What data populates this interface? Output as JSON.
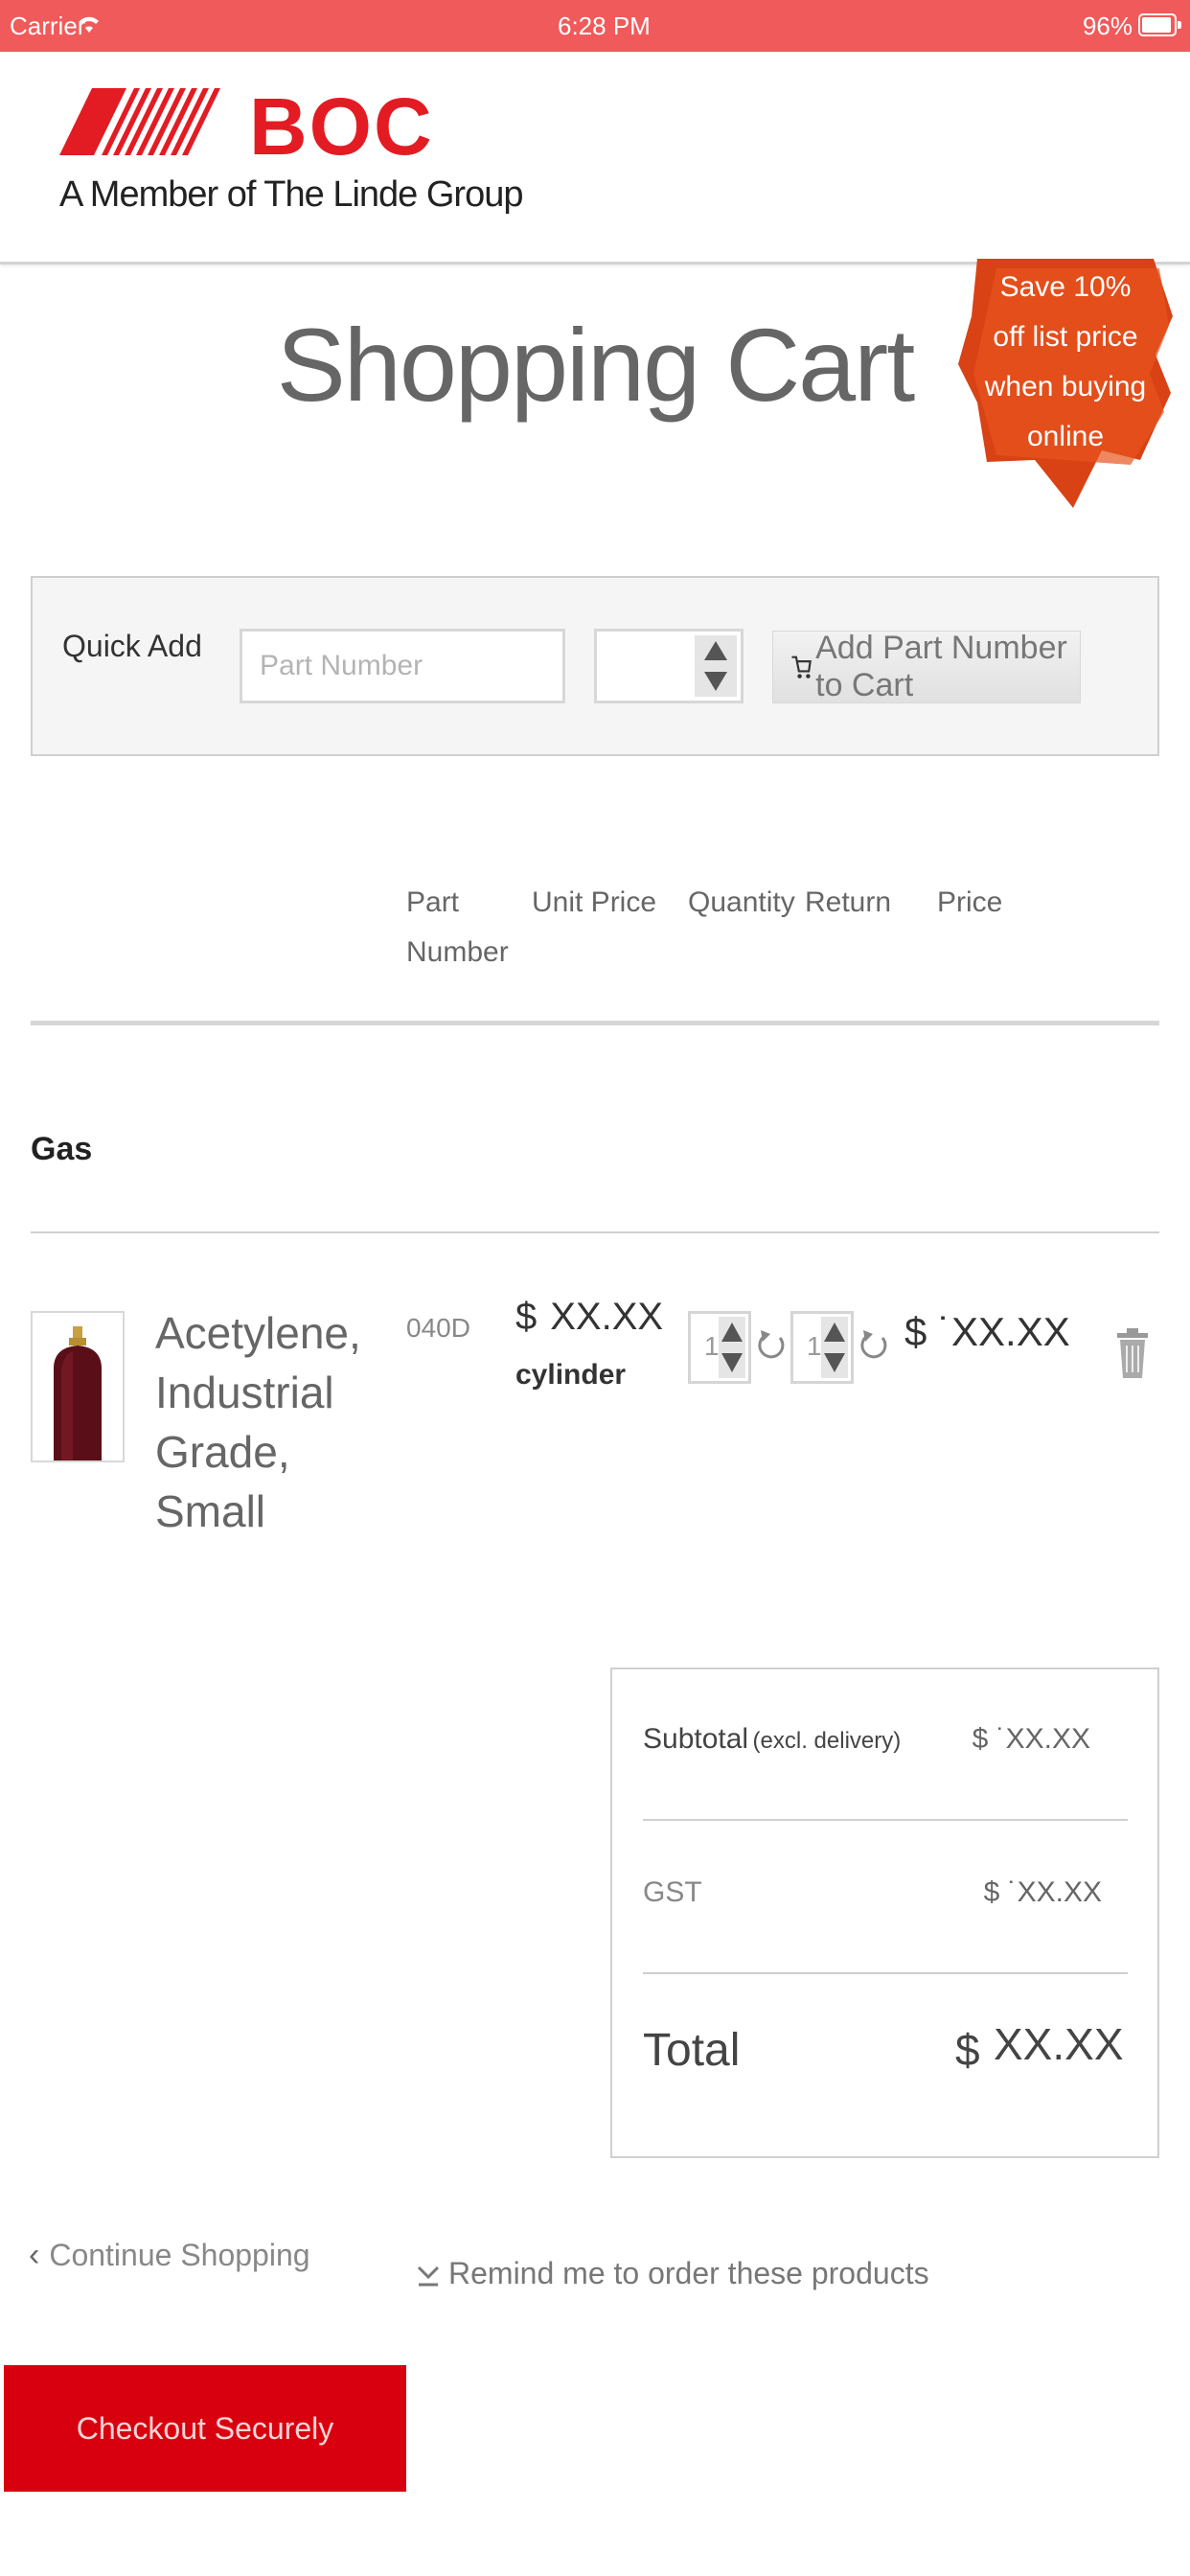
{
  "status_bar": {
    "carrier": "Carrier",
    "time": "6:28 PM",
    "battery": "96%"
  },
  "header": {
    "logo": "BOC",
    "tagline": "A Member of The Linde Group"
  },
  "page_title": "Shopping Cart",
  "badge": {
    "line1": "Save 10%",
    "line2": "off list price",
    "line3": "when buying",
    "line4": "online"
  },
  "quick_add": {
    "label": "Quick Add",
    "part_placeholder": "Part Number",
    "add_button": "Add Part Number to Cart"
  },
  "table_headers": {
    "part_number_line1": "Part",
    "part_number_line2": "Number",
    "unit_price": "Unit Price",
    "quantity": "Quantity",
    "return": "Return",
    "price": "Price"
  },
  "category": "Gas",
  "item": {
    "name_line1": "Acetylene,",
    "name_line2": "Industrial",
    "name_line3": "Grade, Small",
    "part_number": "040D",
    "currency": "$",
    "unit_price": "XX.XX",
    "unit": "cylinder",
    "quantity": "1",
    "return_qty": "1",
    "line_price": "$ ˙XX.XX"
  },
  "totals": {
    "subtotal_label": "Subtotal",
    "subtotal_note": "(excl. delivery)",
    "subtotal_value": "$ ˙XX.XX",
    "gst_label": "GST",
    "gst_value": "$ ˙XX.XX",
    "total_label": "Total",
    "total_currency": "$",
    "total_value": "XX.XX"
  },
  "actions": {
    "continue_shopping": "Continue Shopping",
    "remind": "Remind me to order these products",
    "checkout": "Checkout Securely"
  },
  "colors": {
    "brand_red": "#e31b23",
    "status_bar": "#f15a5a",
    "checkout": "#d8000f",
    "badge": "#e0401a"
  }
}
